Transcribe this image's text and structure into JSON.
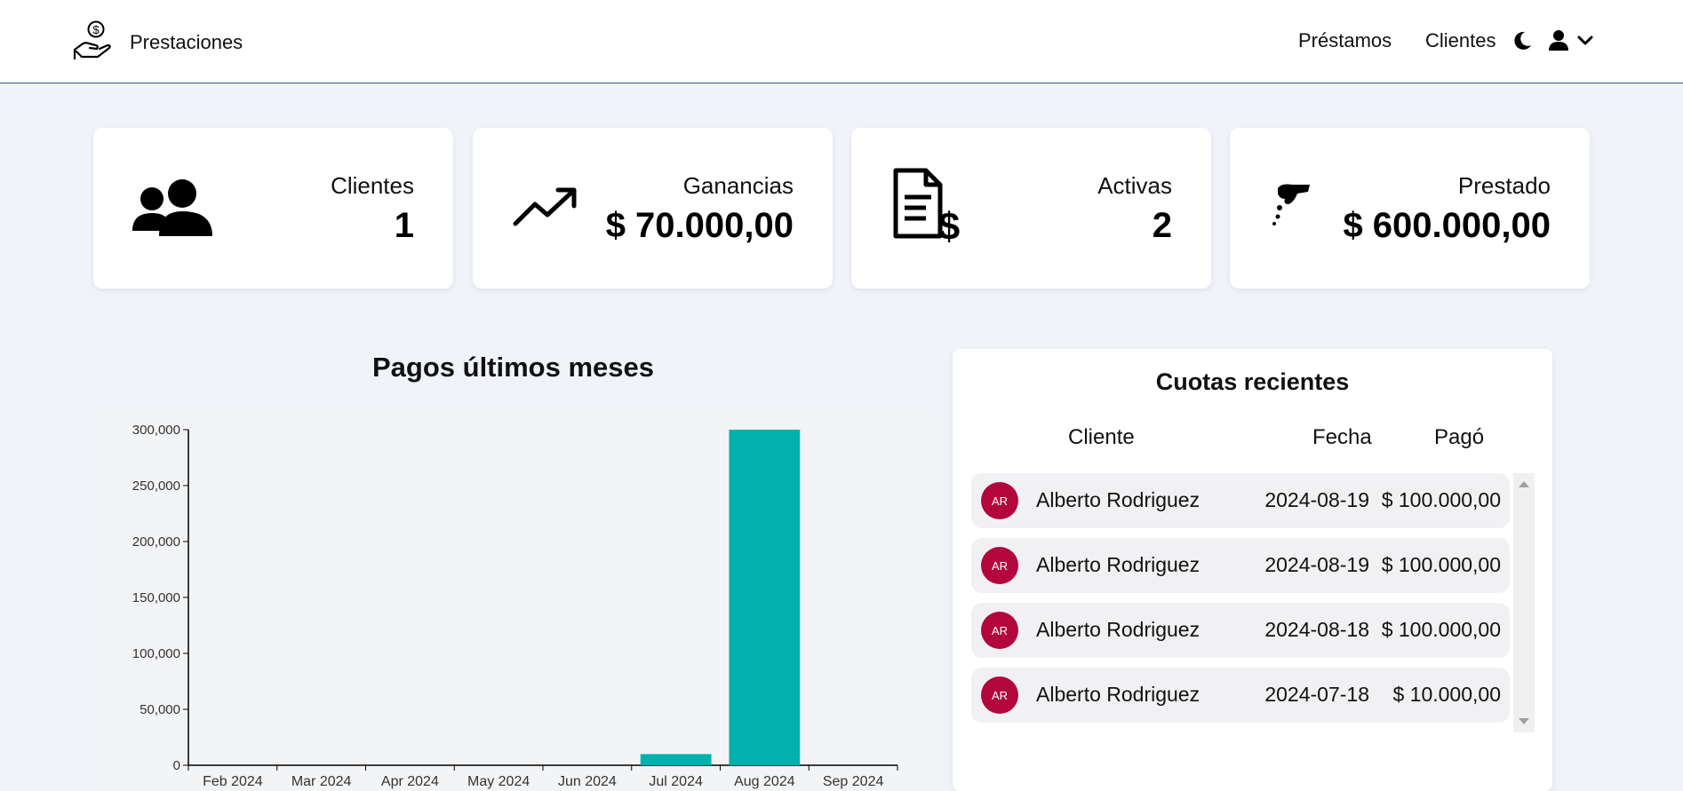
{
  "brand": {
    "name": "Prestaciones",
    "icon": "hand-holding-dollar-icon"
  },
  "nav": {
    "loans": "Préstamos",
    "clients": "Clientes",
    "theme_icon": "moon-icon",
    "user_icon": "user-icon",
    "dropdown_icon": "chevron-down-icon"
  },
  "cards": [
    {
      "icon": "users-icon",
      "title": "Clientes",
      "value": "1"
    },
    {
      "icon": "trending-up-icon",
      "title": "Ganancias",
      "value": "$ 70.000,00"
    },
    {
      "icon": "invoice-dollar-icon",
      "title": "Activas",
      "value": "2"
    },
    {
      "icon": "hand-coins-icon",
      "title": "Prestado",
      "value": "$ 600.000,00"
    }
  ],
  "chart_title": "Pagos últimos meses",
  "chart_data": {
    "type": "bar",
    "title": "",
    "xlabel": "",
    "ylabel": "",
    "categories": [
      "Feb 2024",
      "Mar 2024",
      "Apr 2024",
      "May 2024",
      "Jun 2024",
      "Jul 2024",
      "Aug 2024",
      "Sep 2024"
    ],
    "values": [
      0,
      0,
      0,
      0,
      0,
      10000,
      300000,
      0
    ],
    "ylim": [
      0,
      300000
    ],
    "yticks": [
      0,
      50000,
      100000,
      150000,
      200000,
      250000,
      300000
    ],
    "ytick_labels": [
      "0",
      "50,000",
      "100,000",
      "150,000",
      "200,000",
      "250,000",
      "300,000"
    ],
    "color": "#00b1ad",
    "grid": false
  },
  "recent": {
    "title": "Cuotas recientes",
    "headers": {
      "client": "Cliente",
      "date": "Fecha",
      "paid": "Pagó"
    },
    "rows": [
      {
        "initials": "AR",
        "name": "Alberto Rodriguez",
        "date": "2024-08-19",
        "paid": "$ 100.000,00"
      },
      {
        "initials": "AR",
        "name": "Alberto Rodriguez",
        "date": "2024-08-19",
        "paid": "$ 100.000,00"
      },
      {
        "initials": "AR",
        "name": "Alberto Rodriguez",
        "date": "2024-08-18",
        "paid": "$ 100.000,00"
      },
      {
        "initials": "AR",
        "name": "Alberto Rodriguez",
        "date": "2024-07-18",
        "paid": "$ 10.000,00"
      }
    ]
  },
  "colors": {
    "bar": "#00b1ad",
    "avatar": "#b3063d",
    "nav_border": "#3b5998",
    "background": "#f0f3f8"
  }
}
